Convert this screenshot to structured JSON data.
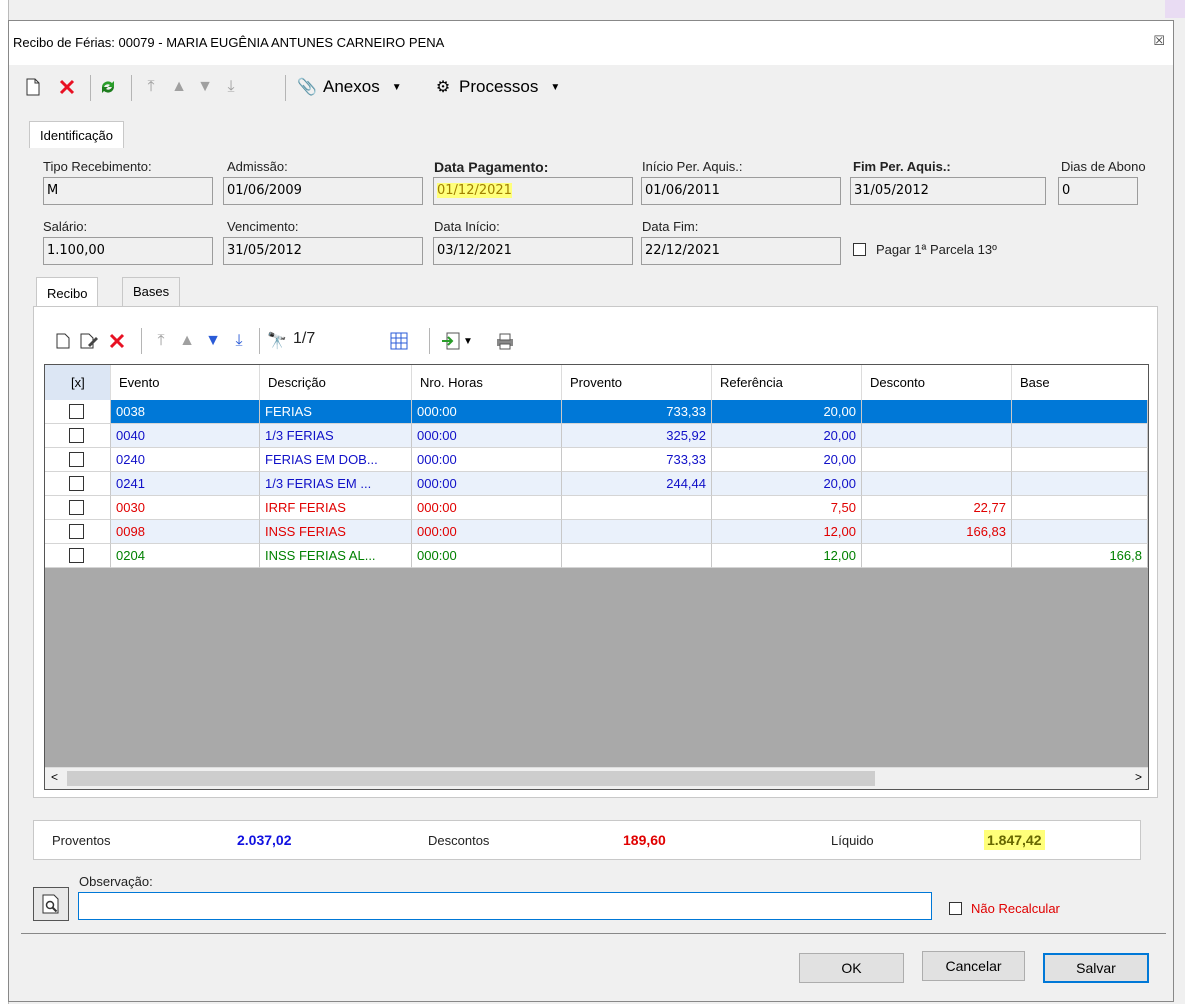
{
  "window": {
    "title": "Recibo de Férias: 00079 - MARIA EUGÊNIA ANTUNES CARNEIRO PENA",
    "close_glyph": "☒"
  },
  "toolbar": {
    "anexos_label": "Anexos",
    "processos_label": "Processos"
  },
  "tabs_top": [
    "Identificação"
  ],
  "form": {
    "tipo_recebimento": {
      "label": "Tipo Recebimento:",
      "value": "M"
    },
    "admissao": {
      "label": "Admissão:",
      "value": "01/06/2009"
    },
    "data_pagamento": {
      "label": "Data Pagamento:",
      "value": "01/12/2021"
    },
    "inicio_per_aquis": {
      "label": "Início Per. Aquis.:",
      "value": "01/06/2011"
    },
    "fim_per_aquis": {
      "label": "Fim Per. Aquis.:",
      "value": "31/05/2012"
    },
    "dias_abono": {
      "label": "Dias de Abono",
      "value": "0"
    },
    "salario": {
      "label": "Salário:",
      "value": "1.100,00"
    },
    "vencimento": {
      "label": "Vencimento:",
      "value": "31/05/2012"
    },
    "data_inicio": {
      "label": "Data Início:",
      "value": "03/12/2021"
    },
    "data_fim": {
      "label": "Data Fim:",
      "value": "22/12/2021"
    },
    "pagar_parcela": {
      "label": "Pagar 1ª Parcela 13º",
      "checked": false
    }
  },
  "tabs_inner": [
    "Recibo",
    "Bases"
  ],
  "grid_toolbar": {
    "page_indicator": "1/7"
  },
  "grid": {
    "columns": [
      "[x]",
      "Evento",
      "Descrição",
      "Nro. Horas",
      "Provento",
      "Referência",
      "Desconto",
      "Base"
    ],
    "rows": [
      {
        "evento": "0038",
        "descricao": "FERIAS",
        "horas": "000:00",
        "provento": "733,33",
        "referencia": "20,00",
        "desconto": "",
        "base": "",
        "color": "#1010c8",
        "selected": true
      },
      {
        "evento": "0040",
        "descricao": "1/3 FERIAS",
        "horas": "000:00",
        "provento": "325,92",
        "referencia": "20,00",
        "desconto": "",
        "base": "",
        "color": "#1010c8",
        "selected": false
      },
      {
        "evento": "0240",
        "descricao": "FERIAS EM DOB...",
        "horas": "000:00",
        "provento": "733,33",
        "referencia": "20,00",
        "desconto": "",
        "base": "",
        "color": "#1010c8",
        "selected": false
      },
      {
        "evento": "0241",
        "descricao": "1/3 FERIAS EM ...",
        "horas": "000:00",
        "provento": "244,44",
        "referencia": "20,00",
        "desconto": "",
        "base": "",
        "color": "#1010c8",
        "selected": false
      },
      {
        "evento": "0030",
        "descricao": "IRRF FERIAS",
        "horas": "000:00",
        "provento": "",
        "referencia": "7,50",
        "desconto": "22,77",
        "base": "",
        "color": "#e00000",
        "selected": false
      },
      {
        "evento": "0098",
        "descricao": "INSS FERIAS",
        "horas": "000:00",
        "provento": "",
        "referencia": "12,00",
        "desconto": "166,83",
        "base": "",
        "color": "#e00000",
        "selected": false
      },
      {
        "evento": "0204",
        "descricao": "INSS FERIAS AL...",
        "horas": "000:00",
        "provento": "",
        "referencia": "12,00",
        "desconto": "",
        "base": "166,8",
        "color": "#008000",
        "selected": false
      }
    ]
  },
  "totals": {
    "proventos_label": "Proventos",
    "proventos_value": "2.037,02",
    "descontos_label": "Descontos",
    "descontos_value": "189,60",
    "liquido_label": "Líquido",
    "liquido_value": "1.847,42"
  },
  "observacao": {
    "label": "Observação:",
    "value": ""
  },
  "nao_recalcular": {
    "label": "Não Recalcular",
    "checked": false
  },
  "buttons": {
    "ok": "OK",
    "cancelar": "Cancelar",
    "salvar": "Salvar"
  },
  "colors": {
    "selected_row": "#0078d7",
    "provento_total": "#1010e0",
    "desconto_total": "#e00000",
    "highlight": "#ffff7a"
  }
}
